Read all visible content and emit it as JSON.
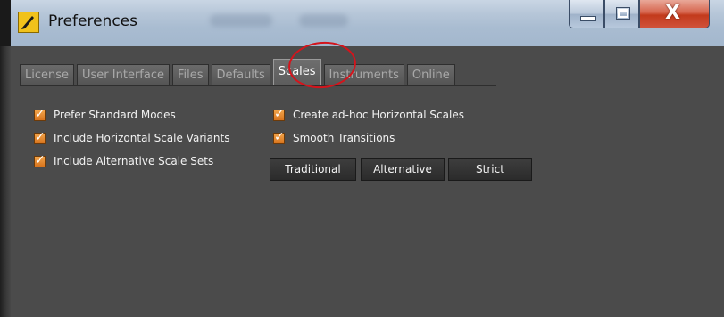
{
  "window": {
    "title": "Preferences",
    "icon": "app-logo-icon",
    "controls": {
      "minimize": "minimize-icon",
      "maximize": "maximize-icon",
      "close_label": "X"
    }
  },
  "tabs": [
    {
      "label": "License",
      "active": false
    },
    {
      "label": "User Interface",
      "active": false
    },
    {
      "label": "Files",
      "active": false
    },
    {
      "label": "Defaults",
      "active": false
    },
    {
      "label": "Scales",
      "active": true
    },
    {
      "label": "Instruments",
      "active": false
    },
    {
      "label": "Online",
      "active": false
    }
  ],
  "options_left": [
    {
      "label": "Prefer Standard Modes",
      "checked": true
    },
    {
      "label": "Include Horizontal Scale Variants",
      "checked": true
    },
    {
      "label": "Include Alternative Scale Sets",
      "checked": true
    }
  ],
  "options_right": [
    {
      "label": "Create ad-hoc Horizontal Scales",
      "checked": true
    },
    {
      "label": "Smooth Transitions",
      "checked": true
    }
  ],
  "buttons": [
    {
      "label": "Traditional"
    },
    {
      "label": "Alternative"
    },
    {
      "label": "Strict"
    }
  ],
  "colors": {
    "panel_bg": "#4b4b4b",
    "checkbox_accent": "#e08a2b",
    "annotation_circle": "#d4141c"
  }
}
